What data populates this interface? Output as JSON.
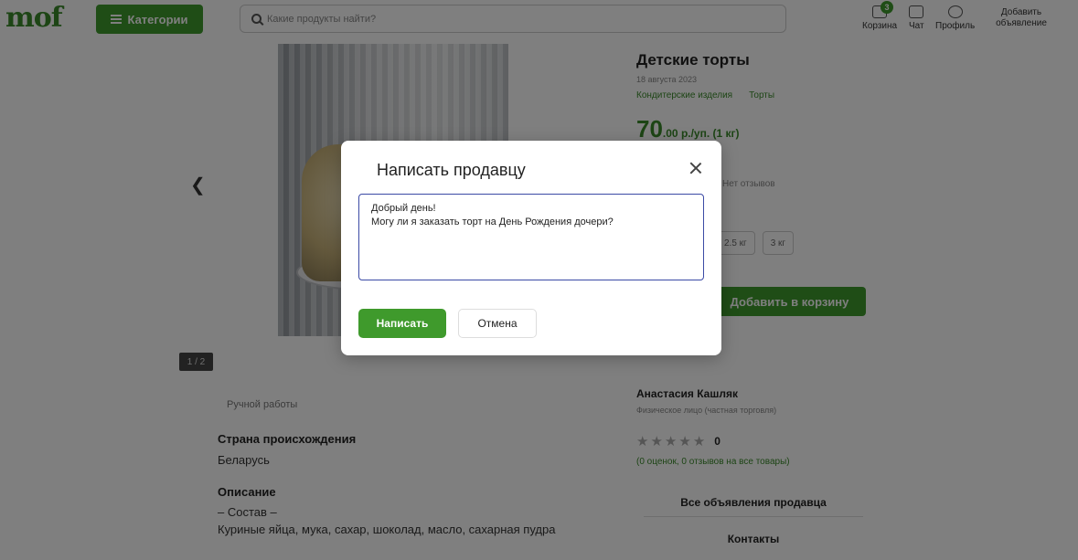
{
  "header": {
    "logo": "mof",
    "categories_label": "Категории",
    "search_placeholder": "Какие продукты найти?",
    "cart_label": "Корзина",
    "cart_count": "3",
    "chat_label": "Чат",
    "profile_label": "Профиль",
    "add_ad_label": "Добавить объявление"
  },
  "gallery": {
    "counter": "1 / 2"
  },
  "product": {
    "title": "Детские торты",
    "date": "18 августа 2023",
    "categories": [
      "Кондитерские изделия",
      "Торты"
    ],
    "price_main": "70",
    "price_suffix": ".00 р./уп. (1 кг)",
    "reviews_short": "Нет отзывов",
    "sizes": [
      "2.5 кг",
      "3 кг"
    ],
    "add_to_cart": "Добавить в корзину",
    "handmade": "Ручной работы",
    "origin_label": "Страна происхождения",
    "origin_value": "Беларусь",
    "description_label": "Описание",
    "description_line1": "– Состав –",
    "description_line2": "Куриные яйца, мука, сахар, шоколад, масло, сахарная пудра"
  },
  "seller": {
    "name": "Анастасия Кашляк",
    "type": "Физическое лицо (частная торговля)",
    "rating_value": "0",
    "rating_note": "(0 оценок, 0 отзывов на все товары)",
    "all_ads": "Все объявления продавца",
    "contacts": "Контакты"
  },
  "modal": {
    "title": "Написать продавцу",
    "message": "Добрый день!\nМогу ли я заказать торт на День Рождения дочери?",
    "send_label": "Написать",
    "cancel_label": "Отмена"
  },
  "colors": {
    "brand_green": "#3f9a2c",
    "textarea_border": "#3b4aa5"
  }
}
